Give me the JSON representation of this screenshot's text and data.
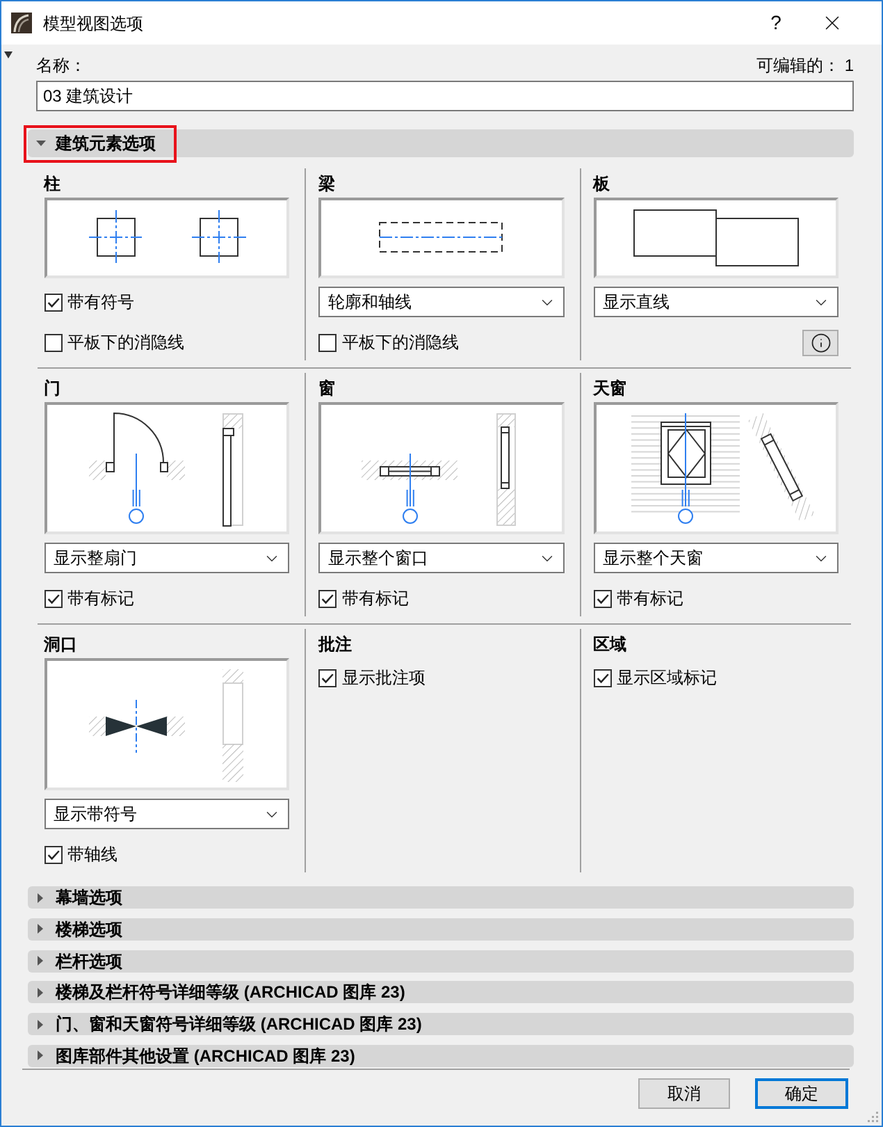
{
  "window": {
    "title": "模型视图选项",
    "help": "?"
  },
  "name_field": {
    "label": "名称：",
    "value": "03 建筑设计"
  },
  "editable_count": "可编辑的： 1",
  "sections": [
    {
      "title": "建筑元素选项",
      "expanded": true,
      "highlighted": true,
      "rows": [
        {
          "panels": [
            {
              "title": "柱",
              "kind": "column",
              "controls": [
                {
                  "kind": "checkbox",
                  "label": "带有符号",
                  "checked": true
                },
                {
                  "kind": "checkbox",
                  "label": "平板下的消隐线",
                  "checked": false
                }
              ]
            },
            {
              "title": "梁",
              "kind": "beam",
              "controls": [
                {
                  "kind": "dropdown",
                  "value": "轮廓和轴线"
                },
                {
                  "kind": "checkbox",
                  "label": "平板下的消隐线",
                  "checked": false
                }
              ]
            },
            {
              "title": "板",
              "kind": "slab",
              "controls": [
                {
                  "kind": "dropdown",
                  "value": "显示直线"
                },
                {
                  "kind": "info"
                }
              ]
            }
          ]
        },
        {
          "panels": [
            {
              "title": "门",
              "kind": "door",
              "controls": [
                {
                  "kind": "dropdown",
                  "value": "显示整扇门"
                },
                {
                  "kind": "checkbox",
                  "label": "带有标记",
                  "checked": true
                }
              ]
            },
            {
              "title": "窗",
              "kind": "window",
              "controls": [
                {
                  "kind": "dropdown",
                  "value": "显示整个窗口"
                },
                {
                  "kind": "checkbox",
                  "label": "带有标记",
                  "checked": true
                }
              ]
            },
            {
              "title": "天窗",
              "kind": "skylight",
              "controls": [
                {
                  "kind": "dropdown",
                  "value": "显示整个天窗"
                },
                {
                  "kind": "checkbox",
                  "label": "带有标记",
                  "checked": true
                }
              ]
            }
          ]
        },
        {
          "panels": [
            {
              "title": "洞口",
              "kind": "opening",
              "controls": [
                {
                  "kind": "dropdown",
                  "value": "显示带符号"
                },
                {
                  "kind": "checkbox",
                  "label": "带轴线",
                  "checked": true
                }
              ]
            },
            {
              "title": "批注",
              "kind": "plain",
              "controls": [
                {
                  "kind": "checkbox",
                  "label": "显示批注项",
                  "checked": true
                }
              ]
            },
            {
              "title": "区域",
              "kind": "plain",
              "controls": [
                {
                  "kind": "checkbox",
                  "label": "显示区域标记",
                  "checked": true
                }
              ]
            }
          ]
        }
      ]
    },
    {
      "title": "幕墙选项",
      "expanded": false,
      "highlighted": false
    },
    {
      "title": "楼梯选项",
      "expanded": false,
      "highlighted": false
    },
    {
      "title": "栏杆选项",
      "expanded": false,
      "highlighted": false
    },
    {
      "title": "楼梯及栏杆符号详细等级 (ARCHICAD 图库 23)",
      "expanded": false,
      "highlighted": false
    },
    {
      "title": "门、窗和天窗符号详细等级 (ARCHICAD 图库 23)",
      "expanded": false,
      "highlighted": false
    },
    {
      "title": "图库部件其他设置 (ARCHICAD 图库 23)",
      "expanded": false,
      "highlighted": false
    }
  ],
  "buttons": [
    {
      "label": "取消",
      "default": false
    },
    {
      "label": "确定",
      "default": true
    }
  ]
}
